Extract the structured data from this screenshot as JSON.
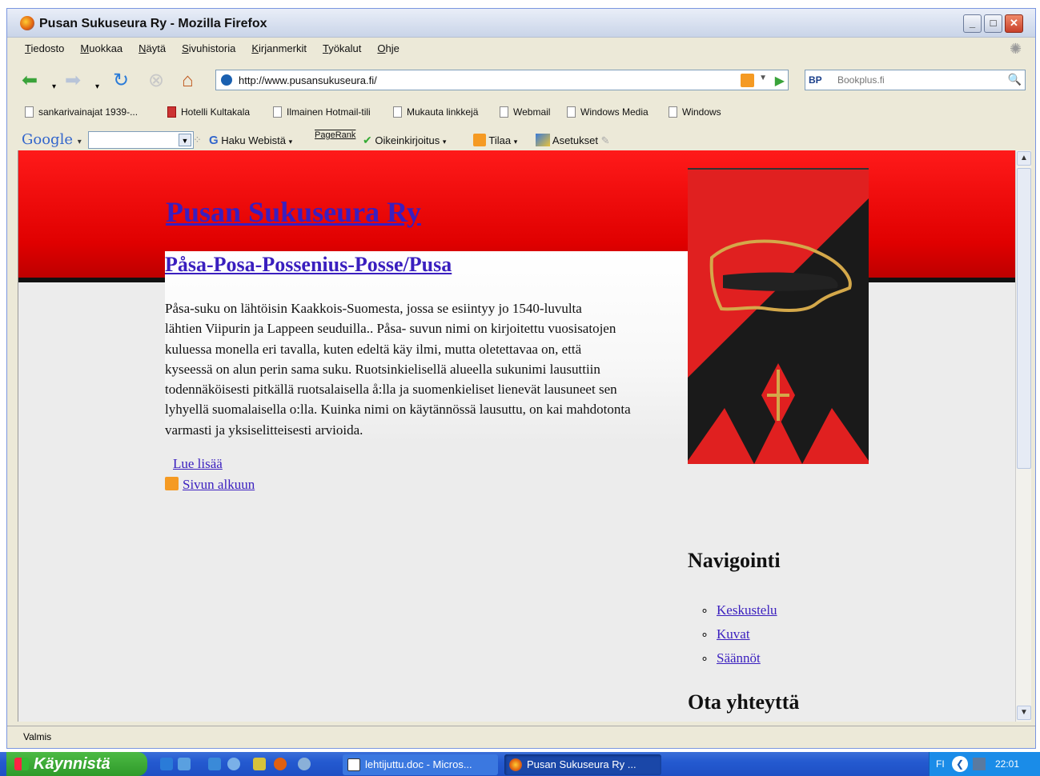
{
  "window": {
    "title": "Pusan Sukuseura Ry - Mozilla Firefox"
  },
  "menu": [
    "Tiedosto",
    "Muokkaa",
    "Näytä",
    "Sivuhistoria",
    "Kirjanmerkit",
    "Työkalut",
    "Ohje"
  ],
  "address": {
    "url": "http://www.pusansukuseura.fi/"
  },
  "search": {
    "engine": "BP",
    "placeholder": "Bookplus.fi"
  },
  "bookmarks": [
    "sankarivainajat 1939-...",
    "Hotelli Kultakala",
    "Ilmainen Hotmail-tili",
    "Mukauta linkkejä",
    "Webmail",
    "Windows Media",
    "Windows"
  ],
  "google_toolbar": {
    "logo": "Google",
    "search_web": "Haku Webistä",
    "pagerank": "PageRank",
    "spell": "Oikeinkirjoitus",
    "subscribe": "Tilaa",
    "settings": "Asetukset"
  },
  "page": {
    "site_title": "Pusan Sukuseura Ry",
    "heading": "Påsa-Posa-Possenius-Posse/Pusa",
    "body_lines": [
      "Påsa-suku on lähtöisin Kaakkois-Suomesta, jossa se esiintyy jo 1540-luvulta",
      "lähtien Viipurin ja Lappeen seuduilla.. Påsa- suvun nimi on kirjoitettu vuosisatojen",
      "kuluessa monella eri tavalla, kuten edeltä käy ilmi, mutta oletettavaa on, että",
      "kyseessä on alun perin sama suku. Ruotsinkielisellä alueella sukunimi lausuttiin",
      "todennäköisesti pitkällä ruotsalaisella å:lla ja suomenkieliset lienevät lausuneet sen",
      "lyhyellä suomalaisella o:lla. Kuinka nimi on käytännössä lausuttu, on kai mahdotonta",
      "varmasti ja yksiselitteisesti arvioida."
    ],
    "read_more": "Lue lisää",
    "back_to_top": "Sivun alkuun",
    "nav_heading": "Navigointi",
    "nav_items": [
      "Keskustelu",
      "Kuvat",
      "Säännöt"
    ],
    "contact_heading": "Ota yhteyttä"
  },
  "status": {
    "text": "Valmis"
  },
  "taskbar": {
    "start": "Käynnistä",
    "tasks": [
      "lehtijuttu.doc - Micros...",
      "Pusan Sukuseura Ry ..."
    ],
    "lang": "FI",
    "clock": "22:01"
  },
  "colors": {
    "banner_red": "#e00000",
    "link": "#3a1fbf",
    "crest_red": "#e02020",
    "crest_black": "#1a1a1a",
    "crest_gold": "#d4a84a"
  }
}
